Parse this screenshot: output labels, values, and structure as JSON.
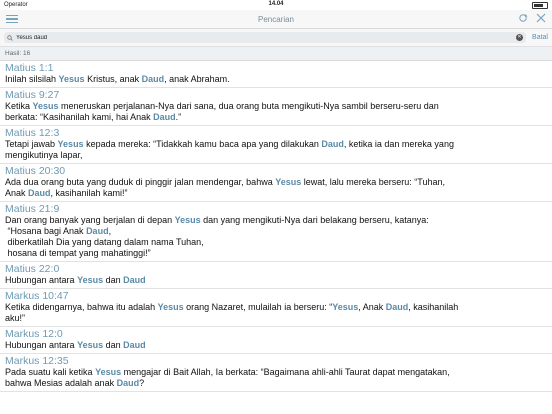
{
  "status": {
    "carrier": "Operator",
    "time": "14.04"
  },
  "navbar": {
    "title": "Pencarian"
  },
  "search": {
    "value": "Yesus daud",
    "cancel_label": "Batal"
  },
  "result_count": "Hasil: 16",
  "verses": [
    {
      "ref": "Matius 1:1",
      "lines": [
        [
          [
            "Inilah silsilah ",
            false
          ],
          [
            "Yesus",
            true
          ],
          [
            " Kristus, anak ",
            false
          ],
          [
            "Daud",
            true
          ],
          [
            ", anak Abraham.",
            false
          ]
        ]
      ]
    },
    {
      "ref": "Matius 9:27",
      "lines": [
        [
          [
            "Ketika ",
            false
          ],
          [
            "Yesus",
            true
          ],
          [
            " meneruskan perjalanan-Nya dari sana, dua orang buta mengikuti-Nya sambil berseru-seru dan",
            false
          ]
        ],
        [
          [
            "berkata: “Kasihanilah kami, hai Anak ",
            false
          ],
          [
            "Daud",
            true
          ],
          [
            ".”",
            false
          ]
        ]
      ]
    },
    {
      "ref": "Matius 12:3",
      "lines": [
        [
          [
            "Tetapi jawab ",
            false
          ],
          [
            "Yesus",
            true
          ],
          [
            " kepada mereka: “Tidakkah kamu baca apa yang dilakukan ",
            false
          ],
          [
            "Daud",
            true
          ],
          [
            ", ketika ia dan mereka yang",
            false
          ]
        ],
        [
          [
            "mengikutinya lapar,",
            false
          ]
        ]
      ]
    },
    {
      "ref": "Matius 20:30",
      "lines": [
        [
          [
            "Ada dua orang buta yang duduk di pinggir jalan mendengar, bahwa ",
            false
          ],
          [
            "Yesus",
            true
          ],
          [
            " lewat, lalu mereka berseru: “Tuhan,",
            false
          ]
        ],
        [
          [
            "Anak ",
            false
          ],
          [
            "Daud",
            true
          ],
          [
            ", kasihanilah kami!”",
            false
          ]
        ]
      ]
    },
    {
      "ref": "Matius 21:9",
      "lines": [
        [
          [
            "Dan orang banyak yang berjalan di depan ",
            false
          ],
          [
            "Yesus",
            true
          ],
          [
            " dan yang mengikuti-Nya dari belakang berseru, katanya:",
            false
          ]
        ],
        [
          [
            " “Hosana bagi Anak ",
            false
          ],
          [
            "Daud",
            true
          ],
          [
            ",",
            false
          ]
        ],
        [
          [
            " diberkatilah Dia yang datang dalam nama Tuhan,",
            false
          ]
        ],
        [
          [
            " hosana di tempat yang mahatinggi!”",
            false
          ]
        ]
      ]
    },
    {
      "ref": "Matius 22:0",
      "lines": [
        [
          [
            "Hubungan antara ",
            false
          ],
          [
            "Yesus",
            true
          ],
          [
            " dan ",
            false
          ],
          [
            "Daud",
            true
          ]
        ]
      ]
    },
    {
      "ref": "Markus 10:47",
      "lines": [
        [
          [
            "Ketika didengarnya, bahwa itu adalah ",
            false
          ],
          [
            "Yesus",
            true
          ],
          [
            " orang Nazaret, mulailah ia berseru: “",
            false
          ],
          [
            "Yesus",
            true
          ],
          [
            ", Anak ",
            false
          ],
          [
            "Daud",
            true
          ],
          [
            ", kasihanilah",
            false
          ]
        ],
        [
          [
            "aku!”",
            false
          ]
        ]
      ]
    },
    {
      "ref": "Markus 12:0",
      "lines": [
        [
          [
            "Hubungan antara ",
            false
          ],
          [
            "Yesus",
            true
          ],
          [
            " dan ",
            false
          ],
          [
            "Daud",
            true
          ]
        ]
      ]
    },
    {
      "ref": "Markus 12:35",
      "lines": [
        [
          [
            "Pada suatu kali ketika ",
            false
          ],
          [
            "Yesus",
            true
          ],
          [
            " mengajar di Bait Allah, Ia berkata: “Bagaimana ahli-ahli Taurat dapat mengatakan,",
            false
          ]
        ],
        [
          [
            "bahwa Mesias adalah anak ",
            false
          ],
          [
            "Daud",
            true
          ],
          [
            "?",
            false
          ]
        ]
      ]
    }
  ]
}
